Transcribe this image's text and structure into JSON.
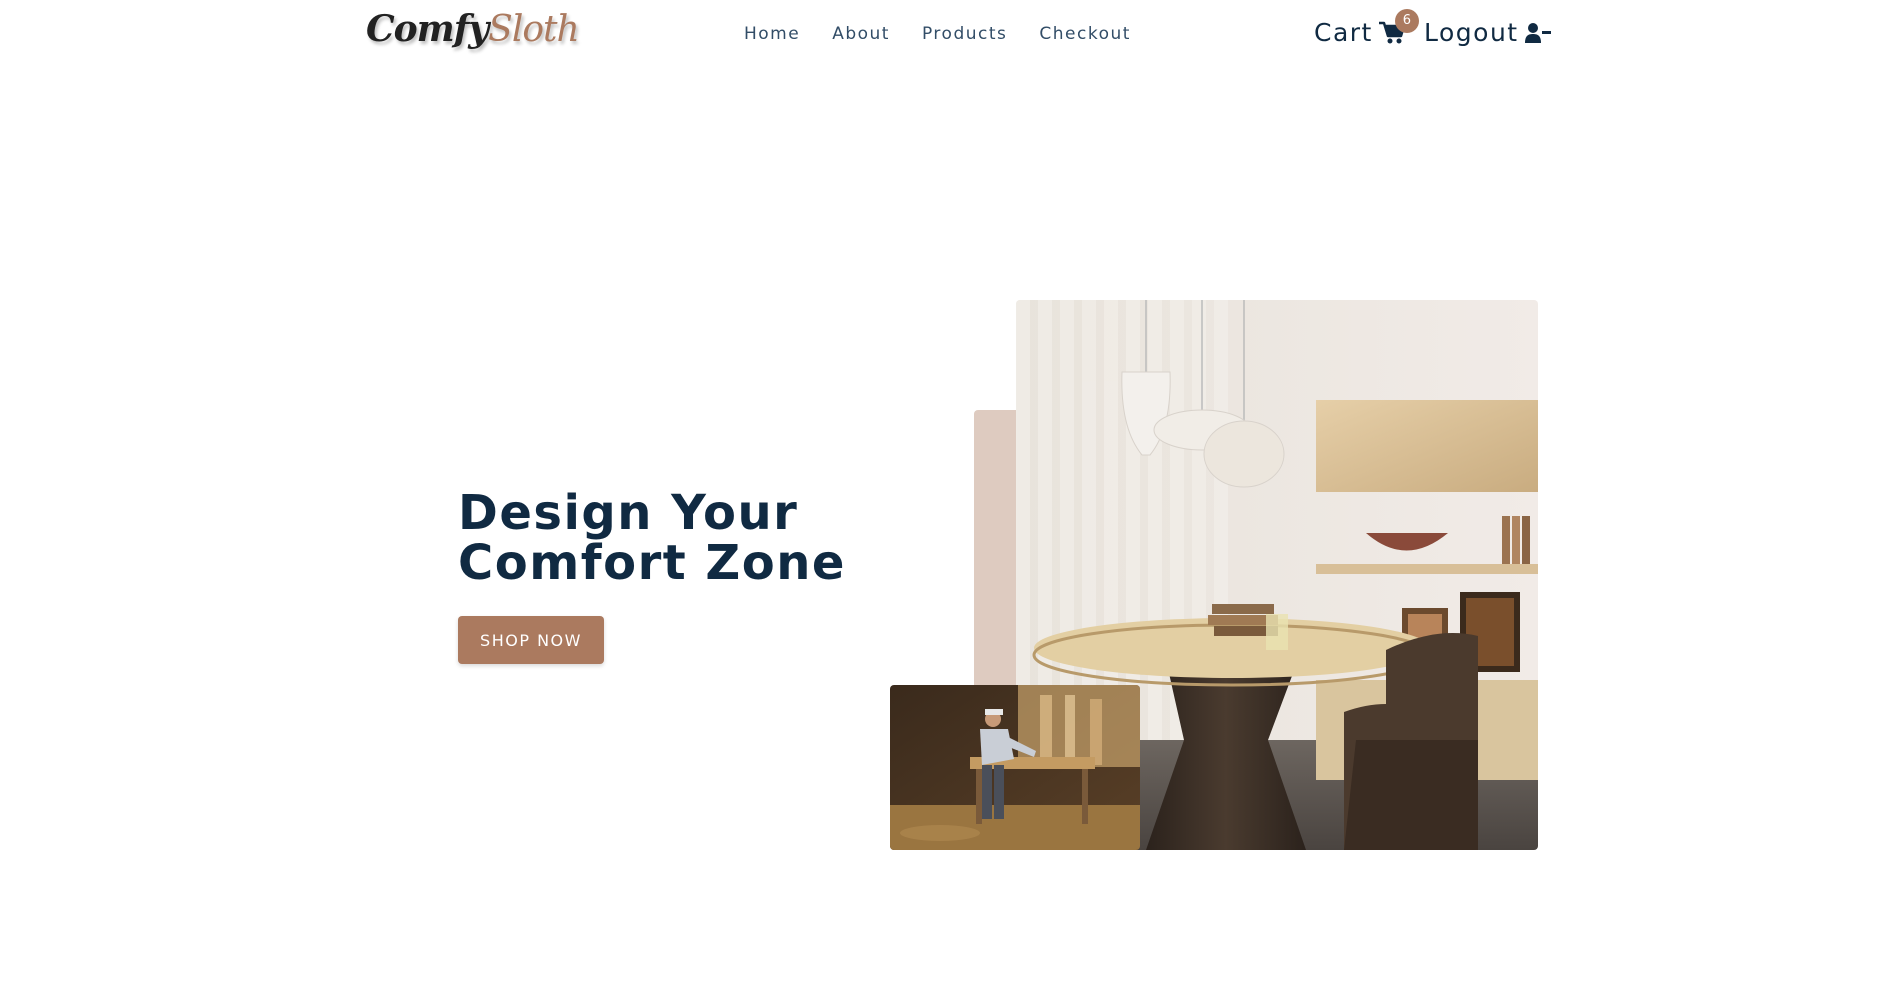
{
  "navbar": {
    "logo_part1": "Comfy",
    "logo_part2": "Sloth",
    "links": [
      "Home",
      "About",
      "Products",
      "Checkout"
    ],
    "cart_label": "Cart",
    "cart_count": "6",
    "logout_label": "Logout"
  },
  "hero": {
    "title_line1": "Design Your",
    "title_line2": "Comfort Zone",
    "shop_button": "SHOP NOW"
  },
  "colors": {
    "brand": "#ab7a5f",
    "heading": "#102a42",
    "nav_text": "#324d67",
    "accent_block": "#decbc0"
  },
  "icons": {
    "cart": "shopping-cart-icon",
    "logout": "user-minus-icon"
  }
}
